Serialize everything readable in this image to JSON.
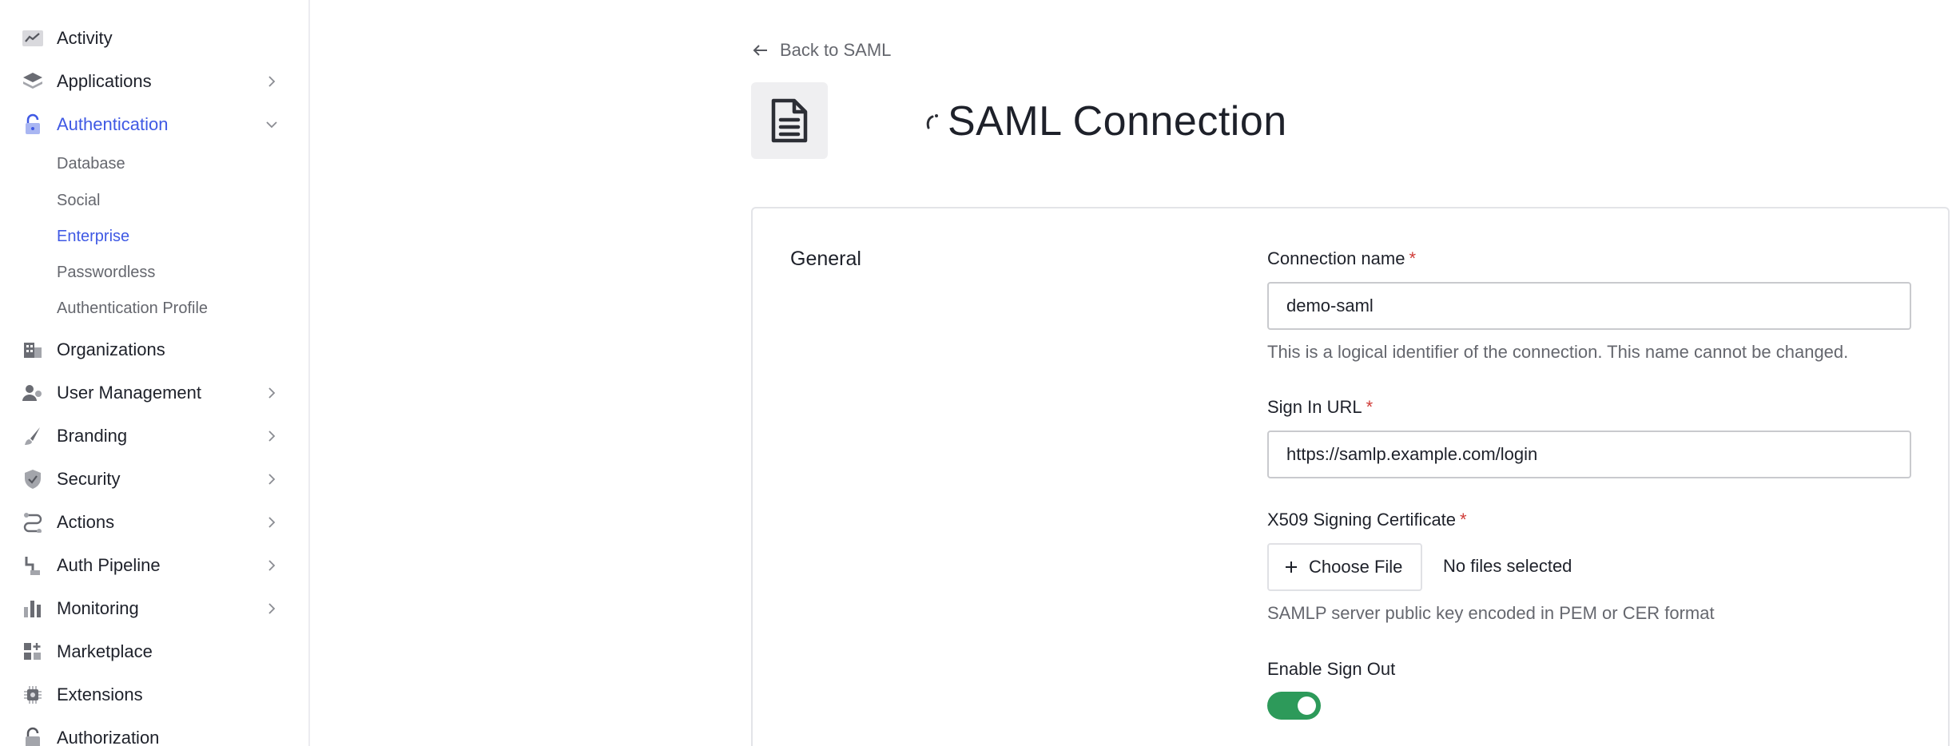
{
  "sidebar": {
    "items": [
      {
        "label": "Activity",
        "icon": "activity-icon"
      },
      {
        "label": "Applications",
        "icon": "applications-icon"
      },
      {
        "label": "Authentication",
        "icon": "lock-icon",
        "active": true,
        "expanded": true
      },
      {
        "label": "Organizations",
        "icon": "building-icon"
      },
      {
        "label": "User Management",
        "icon": "users-icon"
      },
      {
        "label": "Branding",
        "icon": "brush-icon"
      },
      {
        "label": "Security",
        "icon": "shield-icon"
      },
      {
        "label": "Actions",
        "icon": "actions-icon"
      },
      {
        "label": "Auth Pipeline",
        "icon": "pipeline-icon"
      },
      {
        "label": "Monitoring",
        "icon": "bar-chart-icon"
      },
      {
        "label": "Marketplace",
        "icon": "marketplace-icon"
      },
      {
        "label": "Extensions",
        "icon": "extensions-icon"
      },
      {
        "label": "Authorization",
        "icon": "lock-icon"
      }
    ],
    "auth_sub_items": [
      {
        "label": "Database"
      },
      {
        "label": "Social"
      },
      {
        "label": "Enterprise",
        "active": true
      },
      {
        "label": "Passwordless"
      },
      {
        "label": "Authentication Profile"
      }
    ]
  },
  "header": {
    "back_label": "Back to SAML",
    "title": "SAML Connection"
  },
  "form": {
    "section_title": "General",
    "connection_name": {
      "label": "Connection name",
      "required_mark": "*",
      "value": "demo-saml",
      "help": "This is a logical identifier of the connection. This name cannot be changed."
    },
    "sign_in_url": {
      "label": "Sign In URL",
      "required_mark": "*",
      "value": "https://samlp.example.com/login"
    },
    "certificate": {
      "label": "X509 Signing Certificate",
      "required_mark": "*",
      "button_label": "Choose File",
      "status": "No files selected",
      "help": "SAMLP server public key encoded in PEM or CER format"
    },
    "sign_out": {
      "label": "Enable Sign Out",
      "enabled": true
    }
  },
  "colors": {
    "accent": "#3f59e4",
    "toggle_on": "#2d9a5a",
    "required": "#d03c38"
  }
}
